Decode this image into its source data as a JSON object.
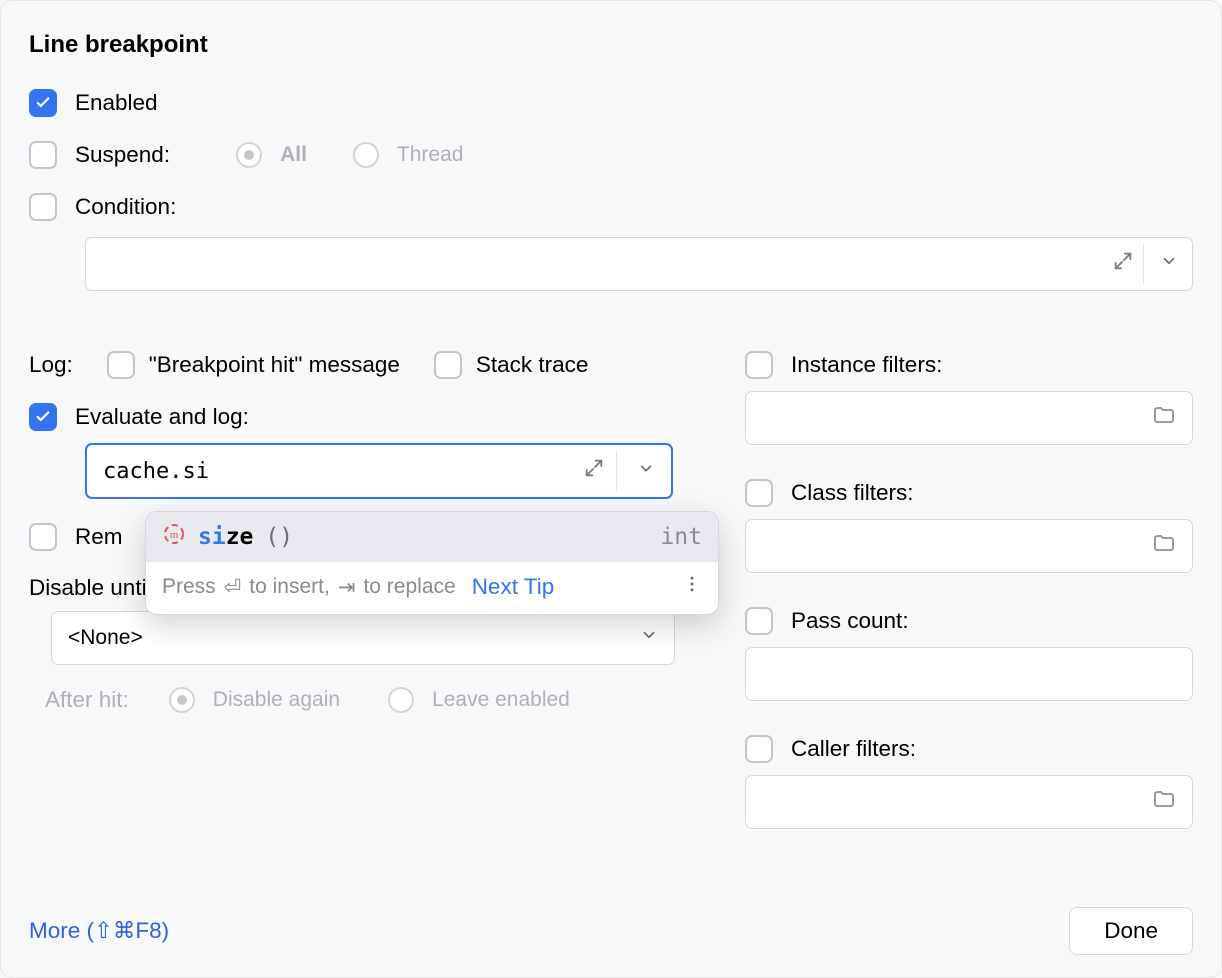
{
  "title": "Line breakpoint",
  "enabled_label": "Enabled",
  "suspend_label": "Suspend:",
  "suspend_all": "All",
  "suspend_thread": "Thread",
  "condition_label": "Condition:",
  "log_label": "Log:",
  "log_bp_hit": "\"Breakpoint hit\" message",
  "log_stack": "Stack trace",
  "eval_label": "Evaluate and log:",
  "eval_value": "cache.si",
  "remove_label": "Rem",
  "disable_until_label": "Disable until hitting the following breakpoint:",
  "disable_select_value": "<None>",
  "after_hit_label": "After hit:",
  "after_hit_disable": "Disable again",
  "after_hit_leave": "Leave enabled",
  "instance_filters": "Instance filters:",
  "class_filters": "Class filters:",
  "pass_count": "Pass count:",
  "caller_filters": "Caller filters:",
  "more_link": "More (⇧⌘F8)",
  "done": "Done",
  "popup": {
    "prefix": "si",
    "rest": "ze",
    "parens": "()",
    "ret": "int",
    "hint_prefix": "Press ",
    "enter": "⏎",
    "hint_mid": " to insert, ",
    "tab": "⇥",
    "hint_end": " to replace",
    "next_tip": "Next Tip"
  }
}
